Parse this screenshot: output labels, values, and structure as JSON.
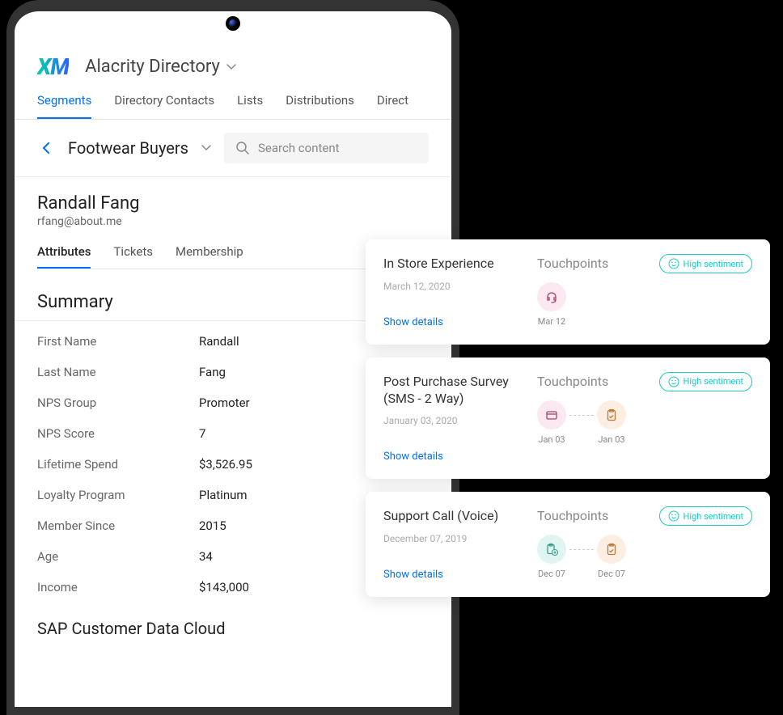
{
  "header": {
    "logo_text": "XM",
    "directory_name": "Alacrity Directory"
  },
  "tabs": {
    "items": [
      "Segments",
      "Directory Contacts",
      "Lists",
      "Distributions",
      "Direct"
    ],
    "active_index": 0
  },
  "segment": {
    "name": "Footwear Buyers",
    "search_placeholder": "Search content"
  },
  "contact": {
    "name": "Randall Fang",
    "email": "rfang@about.me"
  },
  "subtabs": {
    "items": [
      "Attributes",
      "Tickets",
      "Membership"
    ],
    "active_index": 0
  },
  "summary": {
    "title": "Summary",
    "rows": [
      {
        "label": "First Name",
        "value": "Randall"
      },
      {
        "label": "Last Name",
        "value": "Fang"
      },
      {
        "label": "NPS Group",
        "value": "Promoter"
      },
      {
        "label": "NPS Score",
        "value": "7"
      },
      {
        "label": "Lifetime Spend",
        "value": "$3,526.95"
      },
      {
        "label": "Loyalty Program",
        "value": "Platinum"
      },
      {
        "label": "Member Since",
        "value": "2015"
      },
      {
        "label": "Age",
        "value": "34"
      },
      {
        "label": "Income",
        "value": "$143,000"
      }
    ]
  },
  "section2_title": "SAP Customer Data Cloud",
  "cards": [
    {
      "title": "In Store Experience",
      "date": "March 12, 2020",
      "show_details": "Show details",
      "touch_label": "Touchpoints",
      "sentiment": "High sentiment",
      "points": [
        {
          "icon": "headset",
          "bg": "pink",
          "date": "Mar 12"
        }
      ]
    },
    {
      "title": "Post Purchase Survey (SMS - 2 Way)",
      "date": "January 03, 2020",
      "show_details": "Show details",
      "touch_label": "Touchpoints",
      "sentiment": "High sentiment",
      "points": [
        {
          "icon": "card",
          "bg": "pink",
          "date": "Jan 03"
        },
        {
          "icon": "clipboard",
          "bg": "orange",
          "date": "Jan 03"
        }
      ]
    },
    {
      "title": "Support Call (Voice)",
      "date": "December 07, 2019",
      "show_details": "Show details",
      "touch_label": "Touchpoints",
      "sentiment": "High sentiment",
      "points": [
        {
          "icon": "clipboard-plus",
          "bg": "teal",
          "date": "Dec 07"
        },
        {
          "icon": "clipboard",
          "bg": "orange",
          "date": "Dec 07"
        }
      ]
    }
  ]
}
